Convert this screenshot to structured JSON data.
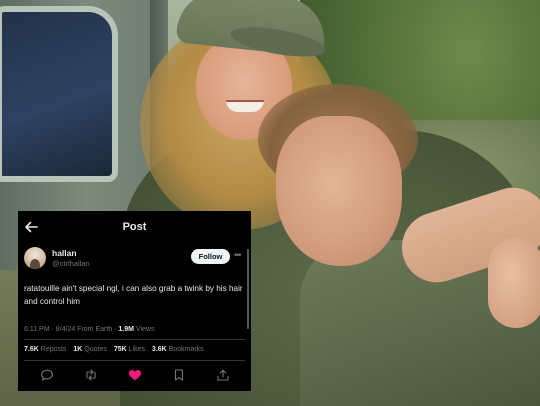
{
  "header": {
    "title": "Post"
  },
  "author": {
    "name": "hallan",
    "handle": "@ctrlhallan",
    "follow_label": "Follow"
  },
  "tweet": {
    "text": "ratatouille ain't special ngl, i can also grab a twink by his hair and control him",
    "time": "6:11 PM · 8/4/24 From Earth · ",
    "views_count": "1.9M",
    "views_label": " Views"
  },
  "stats": [
    {
      "count": "7.6K",
      "label": "Reposts"
    },
    {
      "count": "1K",
      "label": "Quotes"
    },
    {
      "count": "75K",
      "label": "Likes"
    },
    {
      "count": "3.6K",
      "label": "Bookmarks"
    }
  ],
  "actions": {
    "icons": [
      "reply-icon",
      "repost-icon",
      "like-icon",
      "bookmark-icon",
      "share-icon"
    ],
    "like_color": "#f91880",
    "icon_color": "#71767b"
  },
  "colors": {
    "card_bg": "#000000",
    "text": "#e7e9ea",
    "muted": "#71767b"
  }
}
